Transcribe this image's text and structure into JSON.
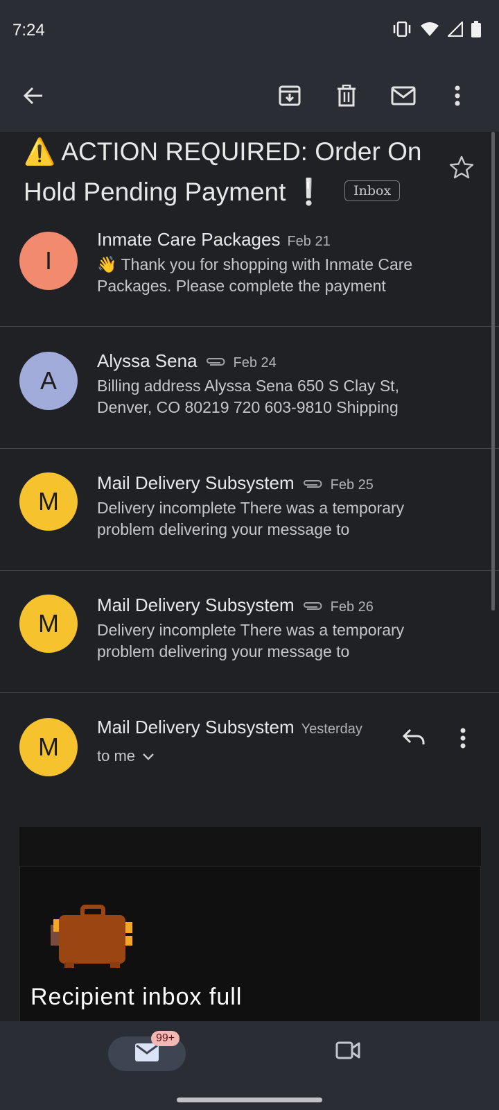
{
  "status": {
    "time": "7:24"
  },
  "thread": {
    "subject_prefix_emoji": "⚠️",
    "subject": "ACTION REQUIRED: Order On Hold Pending Payment",
    "subject_suffix_emoji": "❕",
    "label": "Inbox"
  },
  "messages": [
    {
      "avatar_letter": "I",
      "avatar_color": "#f28b6e",
      "sender": "Inmate Care Packages",
      "date": "Feb 21",
      "attachment": false,
      "snippet": "👋 Thank you for shopping with Inmate Care Packages. Please complete the payment"
    },
    {
      "avatar_letter": "A",
      "avatar_color": "#a2acdb",
      "sender": "Alyssa Sena",
      "date": "Feb 24",
      "attachment": true,
      "snippet": "Billing address Alyssa Sena 650 S Clay St, Denver, CO 80219 720 603-9810 Shipping"
    },
    {
      "avatar_letter": "M",
      "avatar_color": "#f6c32e",
      "sender": "Mail Delivery Subsystem",
      "date": "Feb 25",
      "attachment": true,
      "snippet": "Delivery incomplete There was a temporary problem delivering your message to"
    },
    {
      "avatar_letter": "M",
      "avatar_color": "#f6c32e",
      "sender": "Mail Delivery Subsystem",
      "date": "Feb 26",
      "attachment": true,
      "snippet": "Delivery incomplete There was a temporary problem delivering your message to"
    }
  ],
  "expanded": {
    "avatar_letter": "M",
    "avatar_color": "#f6c32e",
    "sender": "Mail Delivery Subsystem",
    "date": "Yesterday",
    "recipient": "to me",
    "body_heading_partial": "Recipient inbox full"
  },
  "bottom_nav": {
    "mail_badge": "99+"
  },
  "icons": {
    "top_bar": [
      "back-arrow-icon",
      "archive-icon",
      "delete-icon",
      "mark-unread-icon",
      "more-vert-icon"
    ],
    "bottom_nav": [
      "mail-icon",
      "video-icon"
    ]
  }
}
